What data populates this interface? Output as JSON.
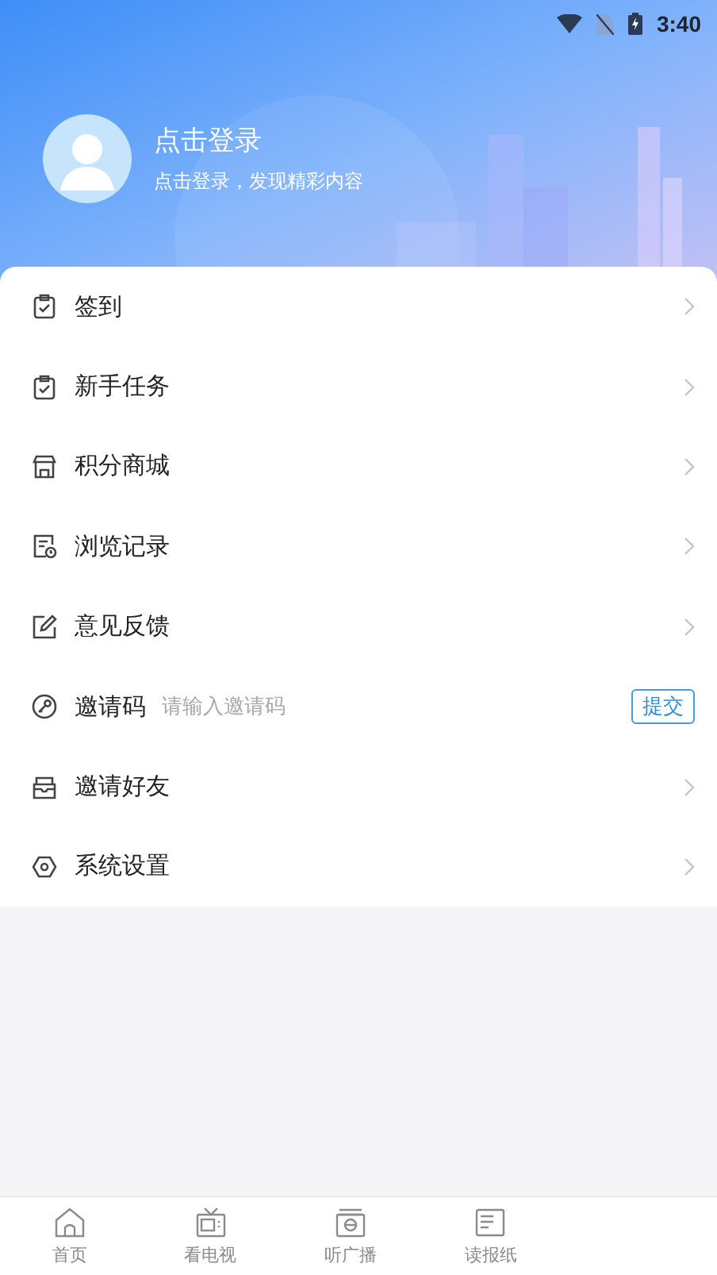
{
  "status_bar": {
    "time": "3:40"
  },
  "profile": {
    "title": "点击登录",
    "subtitle": "点击登录，发现精彩内容"
  },
  "menu": [
    {
      "kind": "link",
      "label": "签到"
    },
    {
      "kind": "link",
      "label": "新手任务"
    },
    {
      "kind": "link",
      "label": "积分商城"
    },
    {
      "kind": "link",
      "label": "浏览记录"
    },
    {
      "kind": "link",
      "label": "意见反馈"
    },
    {
      "kind": "input",
      "label": "邀请码",
      "placeholder": "请输入邀请码",
      "button": "提交"
    },
    {
      "kind": "link",
      "label": "邀请好友"
    },
    {
      "kind": "link",
      "label": "系统设置"
    }
  ],
  "tab_bar": [
    {
      "label": "首页"
    },
    {
      "label": "看电视"
    },
    {
      "label": "听广播"
    },
    {
      "label": "读报纸"
    }
  ]
}
